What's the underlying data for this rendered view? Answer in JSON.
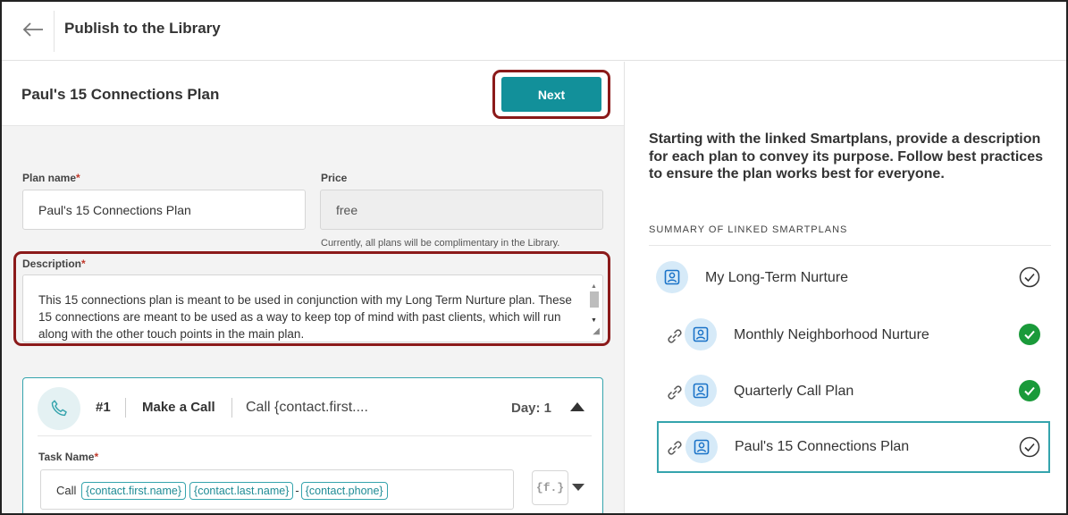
{
  "header": {
    "title": "Publish to the Library"
  },
  "plan_header": {
    "title": "Paul's 15 Connections Plan",
    "next_label": "Next"
  },
  "form": {
    "plan_name_label": "Plan name",
    "required_mark": "*",
    "plan_name_value": "Paul's 15 Connections Plan",
    "price_label": "Price",
    "price_value": "free",
    "price_note": "Currently, all plans will be complimentary in the Library.",
    "description_label": "Description",
    "description_value": "This 15 connections plan is meant to be used in conjunction with my Long Term Nurture plan. These 15 connections are meant to be used as a way to keep top of mind with past clients, which will run along with the other touch points in the main plan."
  },
  "task": {
    "number": "#1",
    "type": "Make a Call",
    "preview": "Call {contact.first....",
    "day": "Day: 1",
    "task_name_label": "Task Name",
    "task_name_prefix": "Call",
    "chips": [
      "{contact.first.name}",
      "{contact.last.name}",
      "{contact.phone}"
    ],
    "separator": "-",
    "field_button": "{f.}"
  },
  "sidebar": {
    "intro": "Starting with the linked Smartplans, provide a description for each plan to convey its purpose. Follow best practices to ensure the plan works best for everyone.",
    "summary_heading": "SUMMARY OF LINKED SMARTPLANS",
    "plans": [
      {
        "name": "My Long-Term Nurture",
        "linked": false,
        "status": "outline-check"
      },
      {
        "name": "Monthly Neighborhood Nurture",
        "linked": true,
        "status": "filled-check"
      },
      {
        "name": "Quarterly Call Plan",
        "linked": true,
        "status": "filled-check"
      },
      {
        "name": "Paul's 15 Connections Plan",
        "linked": true,
        "status": "outline-check",
        "selected": true
      }
    ]
  },
  "colors": {
    "accent": "#12909a",
    "highlight": "#8b1a1a",
    "success": "#1a9a3a"
  },
  "icons": [
    "back-arrow-icon",
    "phone-icon",
    "link-icon",
    "person-icon",
    "check-icon",
    "chevron-up-icon",
    "chevron-down-icon"
  ]
}
